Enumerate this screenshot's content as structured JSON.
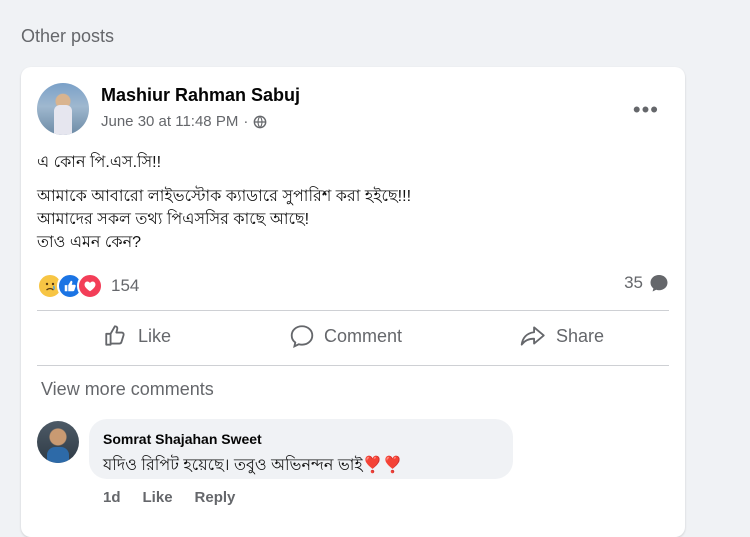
{
  "section": {
    "title": "Other posts"
  },
  "post": {
    "author": "Mashiur Rahman Sabuj",
    "timestamp": "June 30 at 11:48 PM",
    "separator": "·",
    "privacy_icon": "globe-icon",
    "more_label": "•••",
    "text_line_1": "এ কোন পি.এস.সি!!",
    "text_line_2": "আমাকে আবারো লাইভস্টোক ক্যাডারে সুপারিশ করা হইছে!!!",
    "text_line_3": "আমাদের সকল তথ্য পিএসসির কাছে আছে!",
    "text_line_4": "তাও এমন কেন?",
    "reactions": {
      "types": [
        "sad",
        "like",
        "love"
      ],
      "count": "154"
    },
    "comments_count": "35",
    "actions": {
      "like": "Like",
      "comment": "Comment",
      "share": "Share"
    }
  },
  "comments": {
    "view_more": "View more comments",
    "items": [
      {
        "author": "Somrat Shajahan Sweet",
        "text": "যদিও রিপিট হয়েছে। তবুও অভিনন্দন ভাই❣️❣️",
        "time": "1d",
        "like": "Like",
        "reply": "Reply"
      }
    ]
  },
  "colors": {
    "background": "#f0f2f5",
    "card": "#ffffff",
    "secondary_text": "#65676b",
    "like_blue": "#1b74e4",
    "love_red": "#f33e58",
    "sad_yellow": "#f7c544"
  }
}
